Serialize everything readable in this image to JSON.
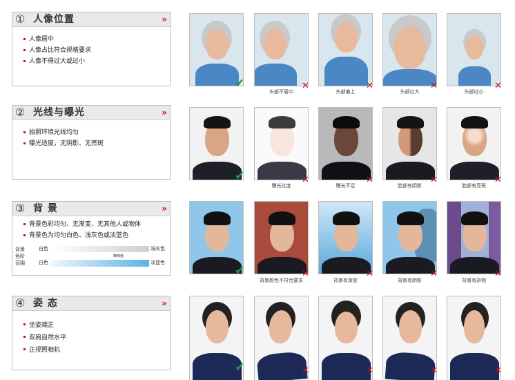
{
  "sections": [
    {
      "number": "①",
      "title": "人像位置",
      "chevron": "»",
      "bullets": [
        "人像居中",
        "人像占比符合规格要求",
        "人像不得过大或过小"
      ],
      "photos": [
        {
          "caption": "",
          "mark": "✔",
          "status": "ok"
        },
        {
          "caption": "头部不居中",
          "mark": "✕",
          "status": "bad"
        },
        {
          "caption": "头部偏上",
          "mark": "✕",
          "status": "bad"
        },
        {
          "caption": "头部过大",
          "mark": "✕",
          "status": "bad"
        },
        {
          "caption": "头部过小",
          "mark": "✕",
          "status": "bad"
        }
      ]
    },
    {
      "number": "②",
      "title": "光线与曝光",
      "chevron": "»",
      "bullets": [
        "拍照环境光线均匀",
        "曝光适度，无阴影、无亮斑"
      ],
      "photos": [
        {
          "caption": "",
          "mark": "✔",
          "status": "ok"
        },
        {
          "caption": "曝光过度",
          "mark": "✕",
          "status": "bad"
        },
        {
          "caption": "曝光不足",
          "mark": "✕",
          "status": "bad"
        },
        {
          "caption": "脸部有阴影",
          "mark": "✕",
          "status": "bad"
        },
        {
          "caption": "脸部有亮斑",
          "mark": "✕",
          "status": "bad"
        }
      ]
    },
    {
      "number": "③",
      "title": "背 景",
      "chevron": "»",
      "bullets": [
        "背景色彩均匀、无渐变、无其他人或物体",
        "背景色为均匀白色、浅灰色或淡蓝色"
      ],
      "scale": {
        "side_label": "背景色阶范围",
        "row1_left": "白色",
        "row1_right": "浅灰色",
        "row2_left": "白色",
        "row2_right": "淡蓝色",
        "note": "推荐值"
      },
      "photos": [
        {
          "caption": "",
          "mark": "✔",
          "status": "ok"
        },
        {
          "caption": "背景颜色不符合要求",
          "mark": "✕",
          "status": "bad"
        },
        {
          "caption": "背景有渐变",
          "mark": "✕",
          "status": "bad"
        },
        {
          "caption": "背景有阴影",
          "mark": "✕",
          "status": "bad"
        },
        {
          "caption": "背景有杂物",
          "mark": "✕",
          "status": "bad"
        }
      ]
    },
    {
      "number": "④",
      "title": "姿 态",
      "chevron": "»",
      "bullets": [
        "坐姿端正",
        "双肩自然水平",
        "正视照相机"
      ],
      "photos": [
        {
          "caption": "",
          "mark": "✔",
          "status": "ok"
        },
        {
          "caption": "",
          "mark": "✕",
          "status": "bad"
        },
        {
          "caption": "",
          "mark": "✕",
          "status": "bad"
        },
        {
          "caption": "",
          "mark": "✕",
          "status": "bad"
        },
        {
          "caption": "",
          "mark": "✕",
          "status": "bad"
        }
      ]
    }
  ],
  "colors": {
    "accent": "#c2101b",
    "ok_mark": "#1c9a4a",
    "panel_header": "#e9e9e9",
    "blue_background": "#8fc6ea",
    "red_background": "#a84b3d"
  }
}
